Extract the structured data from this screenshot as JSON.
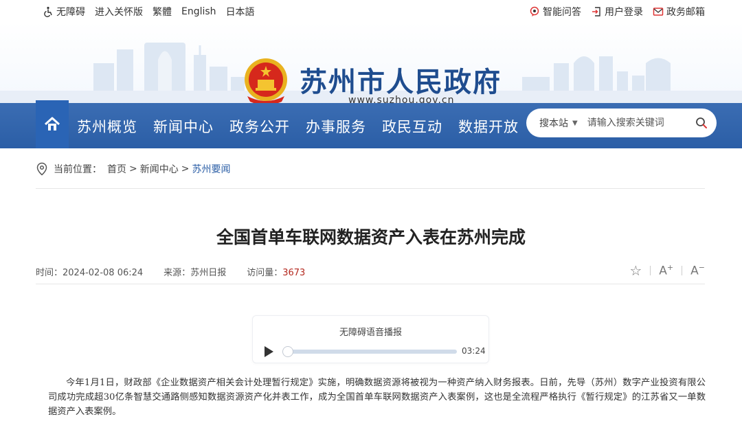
{
  "topbar": {
    "left": [
      {
        "icon": "accessibility-icon",
        "label": "无障碍"
      },
      {
        "label": "进入关怀版"
      },
      {
        "label": "繁體"
      },
      {
        "label": "English"
      },
      {
        "label": "日本語"
      }
    ],
    "right": [
      {
        "icon": "chat-bubble-icon",
        "label": "智能问答"
      },
      {
        "icon": "login-icon",
        "label": "用户登录"
      },
      {
        "icon": "mail-icon",
        "label": "政务邮箱"
      }
    ]
  },
  "header": {
    "title": "苏州市人民政府",
    "url": "www.suzhou.gov.cn",
    "emblem": "national-emblem"
  },
  "nav": {
    "home_icon": "home-icon",
    "items": [
      "苏州概览",
      "新闻中心",
      "政务公开",
      "办事服务",
      "政民互动",
      "数据开放"
    ]
  },
  "search": {
    "scope": "搜本站",
    "placeholder": "请输入搜索关键词",
    "button_icon": "search-icon"
  },
  "breadcrumb": {
    "prefix": "当前位置：",
    "items": [
      "首页",
      "新闻中心",
      "苏州要闻"
    ],
    "separator": ">"
  },
  "article": {
    "title": "全国首单车联网数据资产入表在苏州完成",
    "time_label": "时间：",
    "time": "2024-02-08 06:24",
    "source_label": "来源：",
    "source": "苏州日报",
    "views_label": "访问量：",
    "views": "3673",
    "tools": {
      "favorite": "☆",
      "font_up": "A",
      "font_down": "A"
    },
    "body": "今年1月1日，财政部《企业数据资产相关会计处理暂行规定》实施，明确数据资源将被视为一种资产纳入财务报表。日前，先导（苏州）数字产业投资有限公司成功完成超30亿条智慧交通路侧感知数据资源资产化并表工作，成为全国首单车联网数据资产入表案例，这也是全流程严格执行《暂行规定》的江苏省又一单数据资产入表案例。"
  },
  "audio": {
    "title": "无障碍语音播报",
    "duration": "03:24",
    "progress": 0
  },
  "colors": {
    "nav_bg": "#2b5ea6",
    "title_blue": "#1f4d8f",
    "views_red": "#b4281e"
  }
}
